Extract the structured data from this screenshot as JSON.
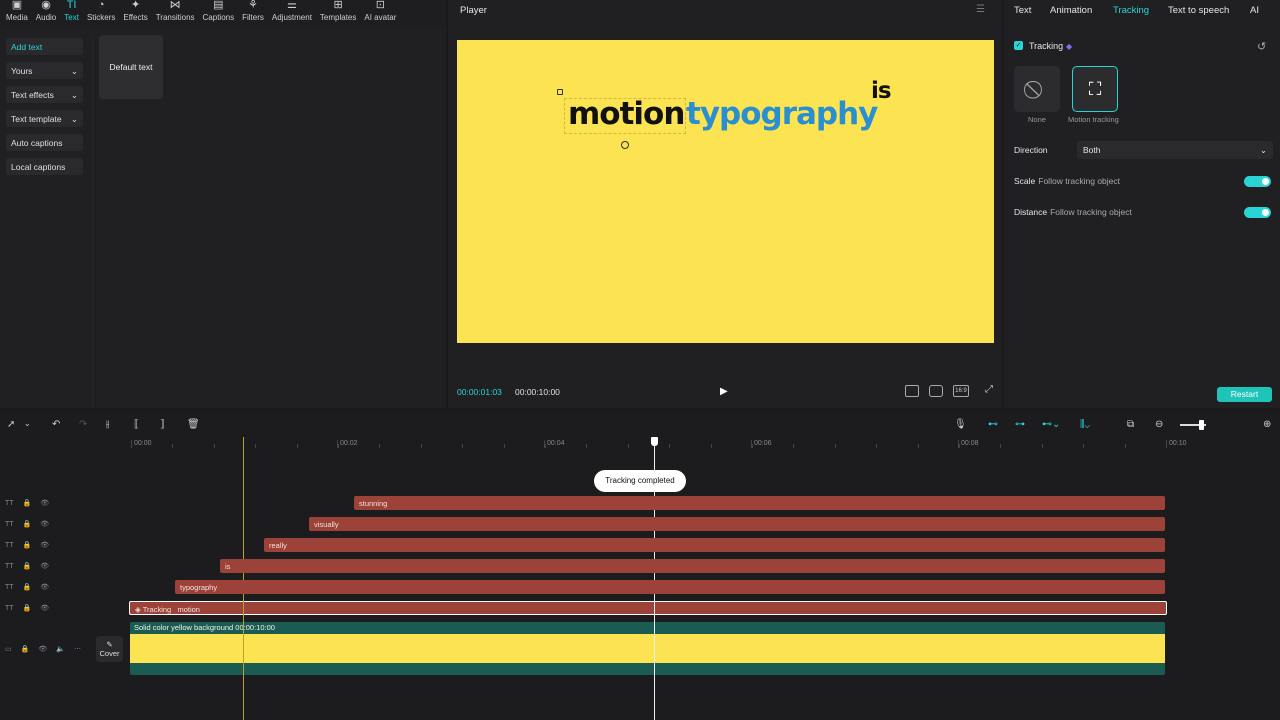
{
  "toolbar": {
    "items": [
      {
        "label": "Media",
        "icon": "media-icon",
        "glyph": "▣"
      },
      {
        "label": "Audio",
        "icon": "audio-icon",
        "glyph": "◉"
      },
      {
        "label": "Text",
        "icon": "text-icon",
        "glyph": "TI"
      },
      {
        "label": "Stickers",
        "icon": "stickers-icon",
        "glyph": "◔"
      },
      {
        "label": "Effects",
        "icon": "effects-icon",
        "glyph": "✦"
      },
      {
        "label": "Transitions",
        "icon": "transitions-icon",
        "glyph": "⋈"
      },
      {
        "label": "Captions",
        "icon": "captions-icon",
        "glyph": "▤"
      },
      {
        "label": "Filters",
        "icon": "filters-icon",
        "glyph": "⚘"
      },
      {
        "label": "Adjustment",
        "icon": "adjustment-icon",
        "glyph": "⚌"
      },
      {
        "label": "Templates",
        "icon": "templates-icon",
        "glyph": "⊞"
      },
      {
        "label": "AI avatar",
        "icon": "ai-avatar-icon",
        "glyph": "⊡"
      }
    ],
    "active_index": 2
  },
  "left_nav": {
    "items": [
      {
        "label": "Add text",
        "chevron": ""
      },
      {
        "label": "Yours",
        "chevron": "⌄"
      },
      {
        "label": "Text effects",
        "chevron": "⌄"
      },
      {
        "label": "Text template",
        "chevron": "⌄"
      },
      {
        "label": "Auto captions",
        "chevron": ""
      },
      {
        "label": "Local captions",
        "chevron": ""
      }
    ]
  },
  "default_text_card": "Default text",
  "player": {
    "title": "Player",
    "menu_glyph": "☰",
    "words": {
      "motion": "motion",
      "typography": "typography",
      "is": "is"
    },
    "current_time": "00:00:01:03",
    "total_time": "00:00:10:00",
    "play_glyph": "▶",
    "ratio_label": "16:9"
  },
  "right_panel": {
    "tabs": [
      "Text",
      "Animation",
      "Tracking",
      "Text to speech",
      "AI"
    ],
    "active_tab": "Tracking",
    "tracking_label": "Tracking",
    "options": [
      {
        "label": "None",
        "glyph": "⃠"
      },
      {
        "label": "Motion tracking",
        "glyph": "⛶"
      }
    ],
    "direction_label": "Direction",
    "direction_value": "Both",
    "scale_label": "Scale",
    "scale_sub": "Follow tracking object",
    "distance_label": "Distance",
    "distance_sub": "Follow tracking object",
    "restart_label": "Restart",
    "accent_color": "#2ad4d4"
  },
  "timeline": {
    "ticks": [
      "00:00",
      "00:02",
      "00:04",
      "00:06",
      "00:08",
      "00:10"
    ],
    "toast": "Tracking completed",
    "clips": [
      {
        "label": "stunning"
      },
      {
        "label": "visually"
      },
      {
        "label": "really"
      },
      {
        "label": "is"
      },
      {
        "label": "typography"
      }
    ],
    "motion_clip": {
      "prefix": "Tracking",
      "label": "motion"
    },
    "background_clip": "Solid color yellow background  00:00:10:00",
    "cover_label": "Cover",
    "clip_color": "#9c4239"
  }
}
